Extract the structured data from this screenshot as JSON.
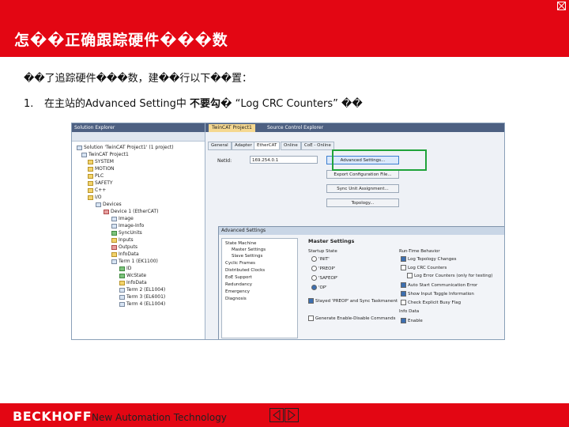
{
  "header": {
    "title": "怎��正确跟踪硬件���数",
    "bg_color": "#e30613"
  },
  "intro": "��了追踪硬件���数，建��行以下��置：",
  "step1": {
    "number": "1.",
    "text_before": "在主站的Advanced Setting中",
    "text_bold": "不要勾�",
    "text_after": "“Log CRC Counters” ��"
  },
  "screenshot": {
    "solution_explorer_title": "Solution Explorer",
    "tree": [
      "Solution 'TwinCAT Project1' (1 project)",
      "TwinCAT Project1",
      "SYSTEM",
      "MOTION",
      "PLC",
      "SAFETY",
      "C++",
      "I/O",
      "Devices",
      "Device 1 (EtherCAT)",
      "Image",
      "Image-Info",
      "SyncUnits",
      "Inputs",
      "Outputs",
      "InfoData",
      "Term 1 (EK1100)",
      "ID",
      "WcState",
      "InfoData",
      "Term 2 (EL1004)",
      "Term 3 (EL6001)",
      "Term 4 (EL1004)"
    ],
    "main_tabs": [
      "TwinCAT Project1",
      "Source Control Explorer"
    ],
    "sub_tabs": [
      "General",
      "Adapter",
      "EtherCAT",
      "Online",
      "CoE - Online"
    ],
    "netid_label": "NetId:",
    "netid_value": "169.254.0.1",
    "buttons": [
      "Advanced Settings...",
      "Export Configuration File...",
      "Sync Unit Assignment...",
      "Topology..."
    ],
    "dialog": {
      "title": "Advanced Settings",
      "tree": [
        "State Machine",
        "Master Settings",
        "Slave Settings",
        "Cyclic Frames",
        "Distributed Clocks",
        "EoE Support",
        "Redundancy",
        "Emergency",
        "Diagnosis"
      ],
      "section_title": "Master Settings",
      "startup_label": "Startup State",
      "states": [
        "'INIT'",
        "'PREOP'",
        "'SAFEOP'",
        "'OP'"
      ],
      "state_selected": "'OP'",
      "extra_checks": [
        "Stayed 'PREOP' and Sync Taskmanent",
        "Generate Enable-Disable Commands"
      ],
      "runtime_label": "Run-Time Behavior",
      "runtime_checks": [
        {
          "label": "Log Topology Changes",
          "checked": true
        },
        {
          "label": "Log CRC Counters",
          "checked": false
        },
        {
          "label": "Log Error Counters (only for testing)",
          "checked": false
        },
        {
          "label": "Auto Start Communication Error",
          "checked": true
        },
        {
          "label": "Show Input Toggle Information",
          "checked": true
        },
        {
          "label": "Check Explicit Busy Flag",
          "checked": false
        }
      ],
      "info_label": "Info Data",
      "info_checks": [
        {
          "label": "Enable",
          "checked": true
        }
      ]
    }
  },
  "footer": {
    "brand": "BECKHOFF",
    "tagline": "New Automation Technology"
  },
  "accent_color": "#1fa33a"
}
